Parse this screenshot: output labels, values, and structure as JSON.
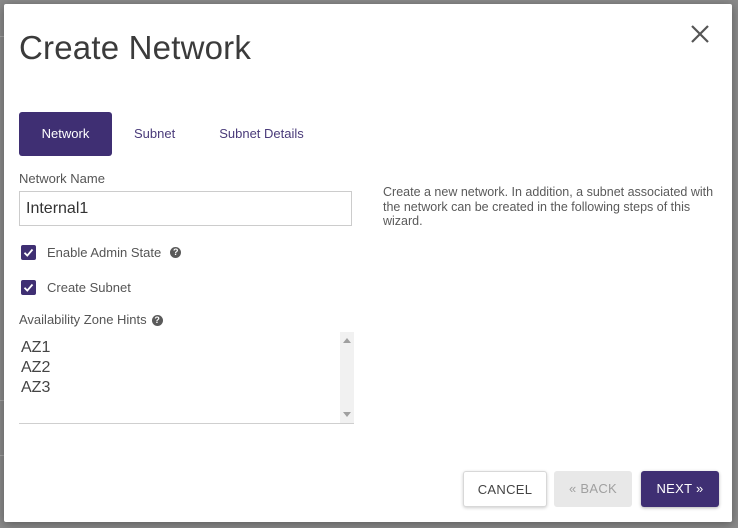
{
  "dialog": {
    "title": "Create Network",
    "close_icon": "close-icon"
  },
  "tabs": [
    {
      "label": "Network",
      "active": true
    },
    {
      "label": "Subnet",
      "active": false
    },
    {
      "label": "Subnet Details",
      "active": false
    }
  ],
  "form": {
    "network_name_label": "Network Name",
    "network_name_value": "Internal1",
    "enable_admin_state": {
      "label": "Enable Admin State",
      "checked": true
    },
    "create_subnet": {
      "label": "Create Subnet",
      "checked": true
    },
    "az_hints_label": "Availability Zone Hints",
    "az_options": [
      "AZ1",
      "AZ2",
      "AZ3"
    ]
  },
  "description": "Create a new network. In addition, a subnet associated with the network can be created in the following steps of this wizard.",
  "buttons": {
    "cancel": "CANCEL",
    "back": "«  BACK",
    "next": "NEXT  »"
  },
  "colors": {
    "accent": "#3f2f73",
    "disabled_bg": "#e8e8e8"
  }
}
